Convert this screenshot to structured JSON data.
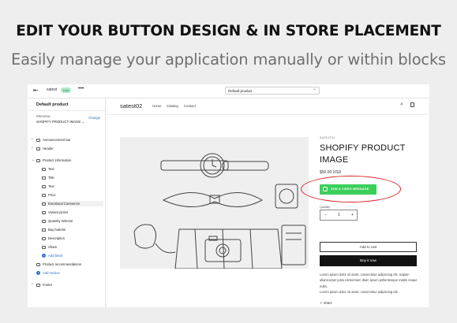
{
  "banner": {
    "headline": "EDIT YOUR BUTTON DESIGN & IN STORE PLACEMENT",
    "subline": "Easily manage your application manually or within blocks"
  },
  "topbar": {
    "store_name": "satest",
    "status_badge": "Live",
    "more": "•••",
    "template_select": "Default product"
  },
  "sidebar": {
    "title": "Default product",
    "preview_label": "PREVIEW",
    "change_label": "Change",
    "preview_product": "SHOPIFY PRODUCT IMAGE",
    "sections": [
      {
        "label": "Announcement bar"
      },
      {
        "label": "Header"
      },
      {
        "label": "Product information"
      }
    ],
    "blocks": [
      {
        "label": "Text"
      },
      {
        "label": "Title"
      },
      {
        "label": "Text"
      },
      {
        "label": "Price"
      },
      {
        "label": "Emotional Commerce"
      },
      {
        "label": "Variant picker"
      },
      {
        "label": "Quantity selector"
      },
      {
        "label": "Buy buttons"
      },
      {
        "label": "Description"
      },
      {
        "label": "Share"
      }
    ],
    "add_block": "Add block",
    "product_recommendations": "Product recommendations",
    "add_section": "Add section",
    "footer": "Footer"
  },
  "store": {
    "logo": "satest02",
    "nav": [
      "Home",
      "Catalog",
      "Contact"
    ],
    "vendor": "SATEST02",
    "product_title": "SHOPIFY PRODUCT IMAGE",
    "price": "$50.00 USD",
    "whatsapp_button": "ADD A VIDEO MESSAGE",
    "quantity_label": "Quantity",
    "quantity_minus": "−",
    "quantity_value": "1",
    "quantity_plus": "+",
    "add_to_cart": "Add to cart",
    "buy_it_now": "Buy it now",
    "description_1": "Lorem ipsum dolor sit amet, consectetur adipiscing elit. Sapien ullamcorper justo elementum diam ipsum pellentesque mattis neque nulla.",
    "description_2": "Lorem ipsum dolor sit amet, consectetur adipiscing elit.",
    "share_label": "Share"
  },
  "colors": {
    "whatsapp_green": "#3bcf5a",
    "highlight_red": "#d6262a",
    "link_blue": "#2c6ecb"
  }
}
